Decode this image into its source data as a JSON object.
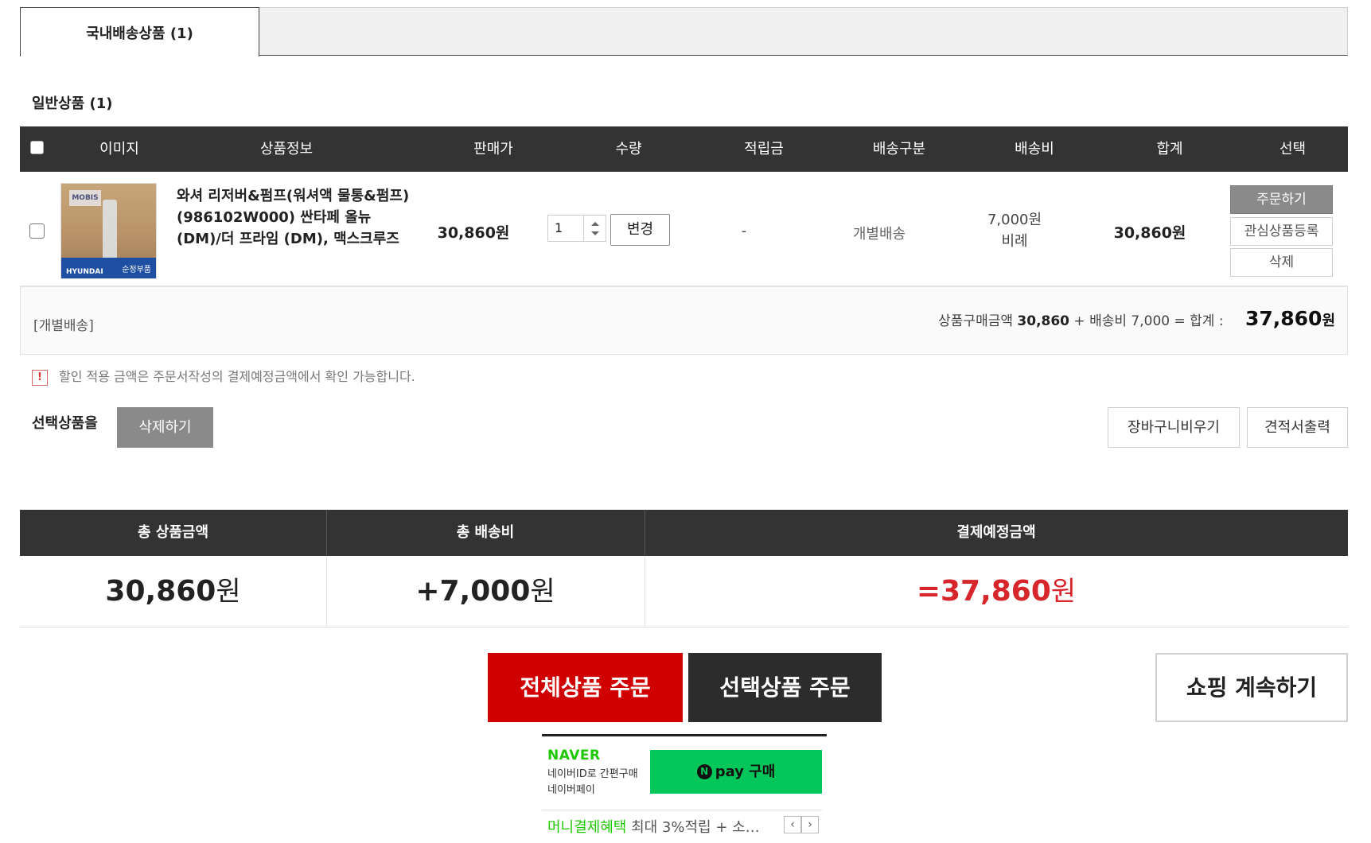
{
  "tabs": {
    "active_label": "국내배송상품 (1)"
  },
  "section": {
    "title": "일반상품 (1)"
  },
  "table": {
    "headers": [
      "이미지",
      "상품정보",
      "판매가",
      "수량",
      "적립금",
      "배송구분",
      "배송비",
      "합계",
      "선택"
    ]
  },
  "item": {
    "image": {
      "logo": "MOBIS",
      "brand": "HYUNDAI",
      "tag": "순정부품"
    },
    "name": "와셔 리저버&펌프(워셔액 물통&펌프) (986102W000) 싼타페 올뉴 (DM)/더 프라임 (DM), 맥스크루즈",
    "price": "30,860원",
    "quantity": "1",
    "change_label": "변경",
    "points": "-",
    "shipping_type": "개별배송",
    "shipping_fee": "7,000원",
    "shipping_fee_note": "비례",
    "total": "30,860원",
    "actions": {
      "order": "주문하기",
      "wishlist": "관심상품등록",
      "delete": "삭제"
    }
  },
  "subtotal": {
    "shipping_label": "[개별배송]",
    "goods_label": "상품구매금액",
    "goods_amount": "30,860",
    "plus": "+",
    "fee_label": "배송비",
    "fee_amount": "7,000",
    "eq": "= 합계 :",
    "total_amount": "37,860",
    "won": "원"
  },
  "notice": {
    "icon": "!",
    "text": "할인 적용 금액은 주문서작성의 결제예정금액에서 확인 가능합니다."
  },
  "selection": {
    "label": "선택상품을",
    "delete_button": "삭제하기",
    "empty_cart_button": "장바구니비우기",
    "quote_button": "견적서출력"
  },
  "totals": {
    "headers": [
      "총 상품금액",
      "총 배송비",
      "결제예정금액"
    ],
    "goods": "30,860",
    "shipping": "+7,000",
    "payment": "=37,860",
    "won": "원"
  },
  "buttons": {
    "order_all": "전체상품 주문",
    "order_selected": "선택상품 주문",
    "continue_shopping": "쇼핑 계속하기"
  },
  "naverpay": {
    "brand": "NAVER",
    "line1": "네이버ID로 간편구매",
    "line2": "네이버페이",
    "button_n": "N",
    "button_label": "pay 구매",
    "benefit_highlight": "머니결제혜택",
    "benefit_text": " 최대 3%적립 + 소…",
    "prev": "‹",
    "next": "›"
  },
  "colors": {
    "accent_red": "#d00000",
    "header_dark": "#333333",
    "naver_green": "#03c75a"
  }
}
